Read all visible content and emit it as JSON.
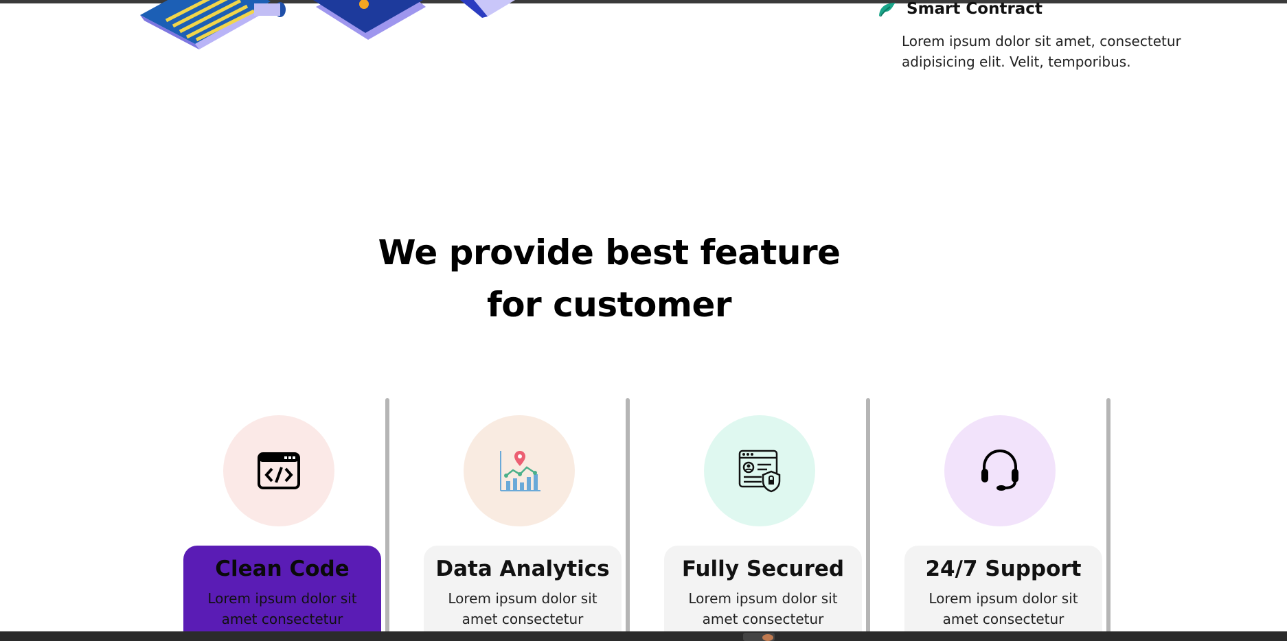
{
  "top_feature": {
    "title": "Smart Contract",
    "description": "Lorem ipsum dolor sit amet, consectetur adipisicing elit. Velit, temporibus.",
    "icon": "leaf-icon"
  },
  "section": {
    "title_line1": "We provide best feature",
    "title_line2": "for customer"
  },
  "cards": [
    {
      "title": "Clean Code",
      "description": "Lorem ipsum dolor sit amet consectetur",
      "icon": "code-window-icon",
      "circle_color": "#fbe9e7",
      "active": true
    },
    {
      "title": "Data Analytics",
      "description": "Lorem ipsum dolor sit amet consectetur",
      "icon": "analytics-chart-icon",
      "circle_color": "#f9ebe1"
    },
    {
      "title": "Fully Secured",
      "description": "Lorem ipsum dolor sit amet consectetur",
      "icon": "secure-profile-icon",
      "circle_color": "#dff8f0"
    },
    {
      "title": "24/7 Support",
      "description": "Lorem ipsum dolor sit amet consectetur",
      "icon": "headset-icon",
      "circle_color": "#f2e3fb"
    }
  ],
  "colors": {
    "accent": "#5a1cb5",
    "leaf": "#1aa68a"
  }
}
